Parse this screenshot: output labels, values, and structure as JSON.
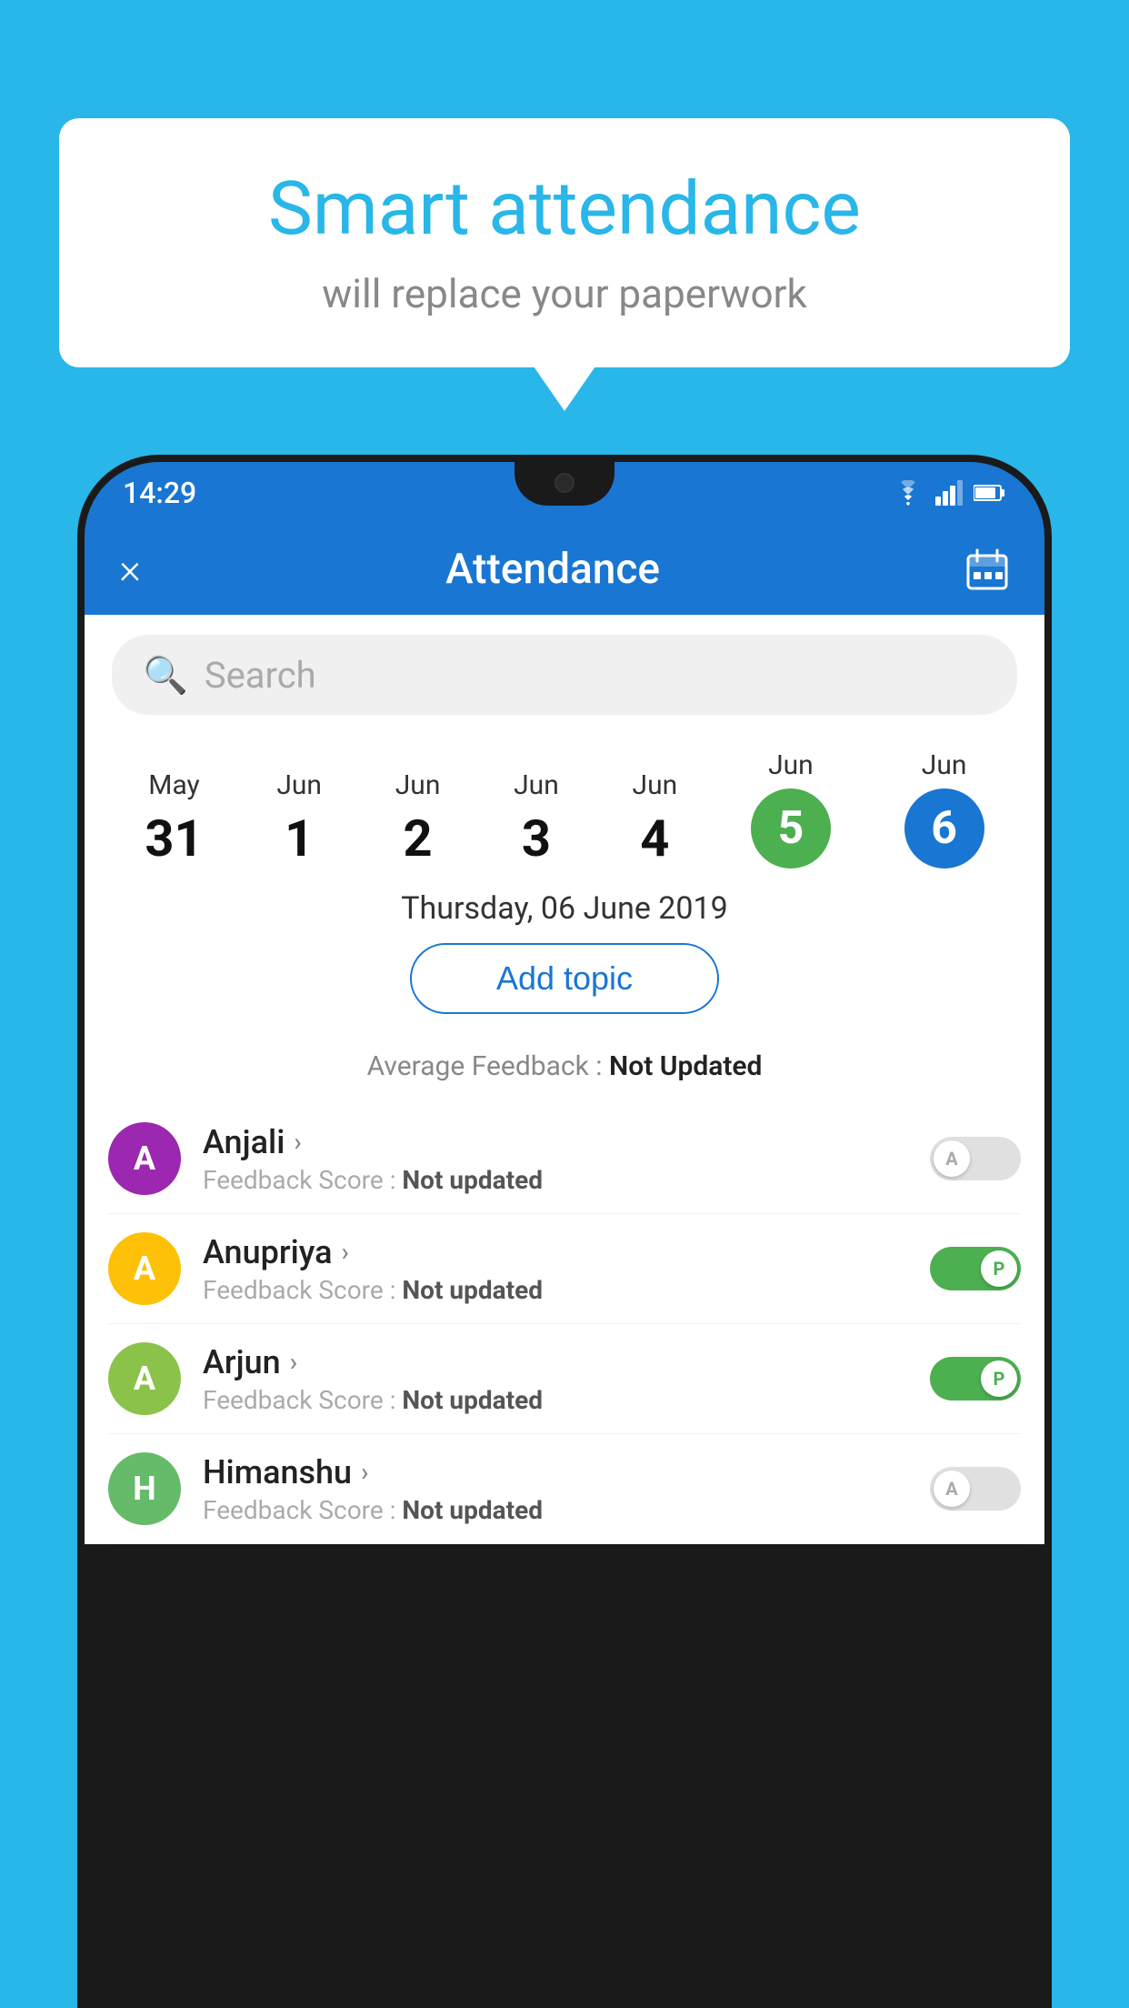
{
  "background_color": "#29B6E8",
  "speech_bubble": {
    "title": "Smart attendance",
    "subtitle": "will replace your paperwork"
  },
  "status_bar": {
    "time": "14:29",
    "icons": [
      "wifi",
      "signal",
      "battery"
    ]
  },
  "header": {
    "title": "Attendance",
    "close_label": "×",
    "calendar_label": "📅"
  },
  "search": {
    "placeholder": "Search"
  },
  "calendar": {
    "dates": [
      {
        "month": "May",
        "day": "31",
        "selected": false
      },
      {
        "month": "Jun",
        "day": "1",
        "selected": false
      },
      {
        "month": "Jun",
        "day": "2",
        "selected": false
      },
      {
        "month": "Jun",
        "day": "3",
        "selected": false
      },
      {
        "month": "Jun",
        "day": "4",
        "selected": false
      },
      {
        "month": "Jun",
        "day": "5",
        "selected": "green"
      },
      {
        "month": "Jun",
        "day": "6",
        "selected": "blue"
      }
    ]
  },
  "selected_date_label": "Thursday, 06 June 2019",
  "add_topic_label": "Add topic",
  "average_feedback": {
    "label": "Average Feedback :",
    "value": "Not Updated"
  },
  "students": [
    {
      "name": "Anjali",
      "feedback_label": "Feedback Score :",
      "feedback_value": "Not updated",
      "avatar_letter": "A",
      "avatar_color": "purple",
      "toggle": "off"
    },
    {
      "name": "Anupriya",
      "feedback_label": "Feedback Score :",
      "feedback_value": "Not updated",
      "avatar_letter": "A",
      "avatar_color": "yellow",
      "toggle": "on"
    },
    {
      "name": "Arjun",
      "feedback_label": "Feedback Score :",
      "feedback_value": "Not updated",
      "avatar_letter": "A",
      "avatar_color": "light-green",
      "toggle": "on"
    },
    {
      "name": "Himanshu",
      "feedback_label": "Feedback Score :",
      "feedback_value": "Not updated",
      "avatar_letter": "H",
      "avatar_color": "green-dark",
      "toggle": "off"
    }
  ]
}
